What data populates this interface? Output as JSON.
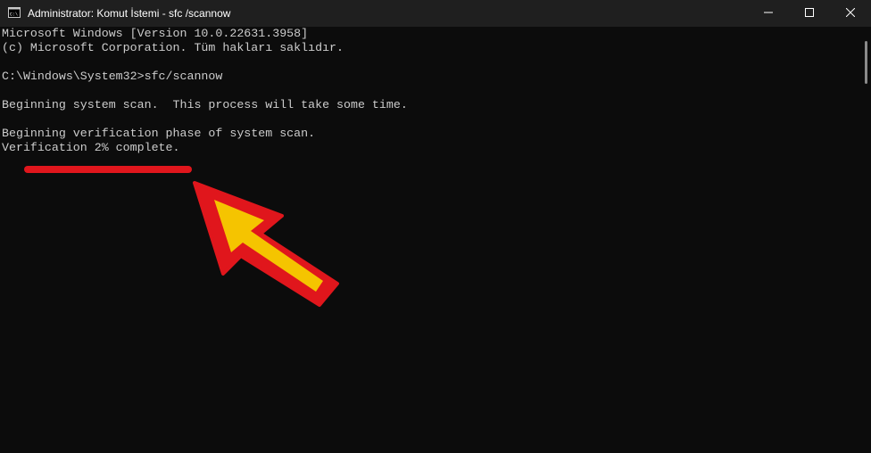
{
  "window": {
    "title": "Administrator: Komut İstemi - sfc /scannow",
    "app_icon": "cmd-prompt-icon",
    "controls": [
      "minimize-icon",
      "maximize-icon",
      "close-icon"
    ]
  },
  "console": {
    "lines": [
      "Microsoft Windows [Version 10.0.22631.3958]",
      "(c) Microsoft Corporation. Tüm hakları saklıdır.",
      "",
      "C:\\Windows\\System32>sfc/scannow",
      "",
      "Beginning system scan.  This process will take some time.",
      "",
      "Beginning verification phase of system scan.",
      "Verification 2% complete."
    ]
  },
  "annotation": {
    "underline_color": "#e0161c",
    "arrow_fill": "#f5c400",
    "arrow_outline": "#e0161c",
    "arrow_icon": "pointer-arrow-icon"
  },
  "colors": {
    "background": "#0c0c0c",
    "titlebar": "#1f1f1f",
    "text": "#cccccc"
  }
}
